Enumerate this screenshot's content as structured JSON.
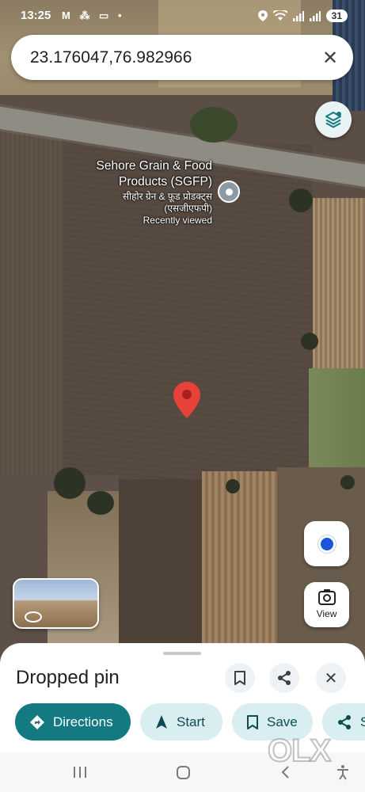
{
  "status_bar": {
    "time": "13:25",
    "left_icons": "M ⁂ ▭ •",
    "battery": "31",
    "icons": [
      "location-icon",
      "wifi-icon",
      "signal-icon",
      "signal-icon"
    ]
  },
  "search": {
    "value": "23.176047,76.982966",
    "clear_icon": "close-icon"
  },
  "map": {
    "type": "satellite",
    "place": {
      "name": "Sehore Grain & Food Products (SGFP)",
      "name_hindi": "सीहोर ग्रेन & फ़ूड प्रोडक्ट्स (एसजीएफपी)",
      "subtitle": "Recently viewed"
    },
    "pin_color": "#e8413a"
  },
  "controls": {
    "layers_icon": "layers-icon",
    "my_location_icon": "my-location-icon",
    "view_label": "View"
  },
  "sheet": {
    "title": "Dropped pin",
    "actions": {
      "save_icon": "bookmark-icon",
      "share_icon": "share-icon",
      "close_icon": "close-icon"
    },
    "chips": {
      "directions": "Directions",
      "start": "Start",
      "save": "Save",
      "share": "Sh"
    }
  },
  "watermark": "OLX",
  "colors": {
    "primary": "#127a80",
    "chip_secondary_bg": "#d8eef0",
    "location_dot": "#1a56db"
  }
}
